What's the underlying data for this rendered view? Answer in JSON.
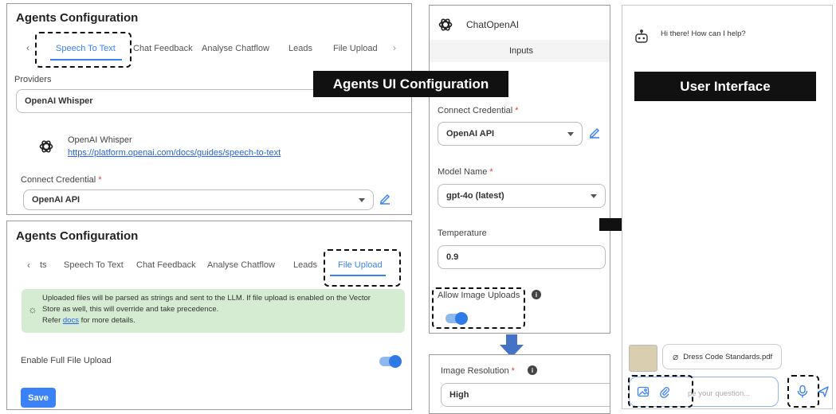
{
  "stt_panel": {
    "title": "Agents Configuration",
    "tabs": [
      "Speech To Text",
      "Chat Feedback",
      "Analyse Chatflow",
      "Leads",
      "File Upload"
    ],
    "providers_label": "Providers",
    "provider_value": "OpenAI Whisper",
    "provider_name": "OpenAI Whisper",
    "provider_link": "https://platform.openai.com/docs/guides/speech-to-text",
    "credential_label": "Connect Credential",
    "required_mark": "*",
    "credential_value": "OpenAI API"
  },
  "upload_panel": {
    "title": "Agents Configuration",
    "tabs": [
      "ts",
      "Speech To Text",
      "Chat Feedback",
      "Analyse Chatflow",
      "Leads",
      "File Upload"
    ],
    "info_line1": "Uploaded files will be parsed as strings and sent to the LLM. If file upload is enabled on the Vector",
    "info_line2": "Store as well, this will override and take precedence.",
    "info_refer": "Refer",
    "info_link": "docs",
    "info_after": "for more details.",
    "full_upload_label": "Enable Full File Upload",
    "full_upload_enabled": true,
    "save_label": "Save"
  },
  "banners": {
    "agents_ui": "Agents UI Configuration",
    "user_interface": "User Interface"
  },
  "chat_node": {
    "title": "ChatOpenAI",
    "section": "Inputs",
    "credential_label": "Connect Credential",
    "credential_value": "OpenAI API",
    "model_label": "Model Name",
    "model_value": "gpt-4o (latest)",
    "temperature_label": "Temperature",
    "temperature_value": "0.9",
    "image_uploads_label": "Allow Image Uploads",
    "image_uploads_enabled": true,
    "resolution_label": "Image Resolution",
    "resolution_value": "High",
    "required_mark": "*"
  },
  "chat_ui": {
    "greeting": "Hi there! How can I help?",
    "attachment": "Dress Code Standards.pdf",
    "placeholder": "Type your question...",
    "visible_placeholder": "pe your question..."
  },
  "colors": {
    "accent": "#3b82f6",
    "info_bg": "#d5ecd3",
    "arrow_blue": "#4472c4",
    "banner_bg": "#111111"
  }
}
